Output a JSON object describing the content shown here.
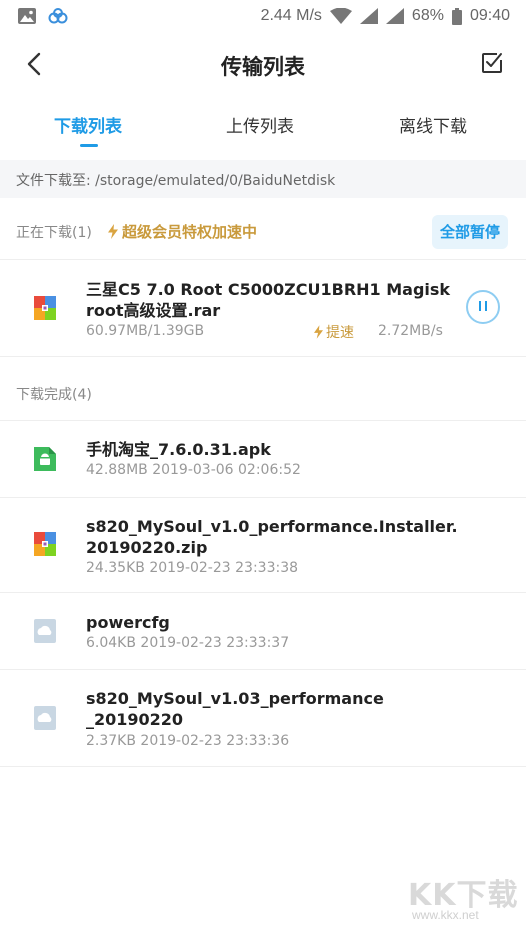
{
  "status_bar": {
    "speed": "2.44 M/s",
    "battery": "68%",
    "time": "09:40",
    "icons": [
      "image-icon",
      "cloud-app-icon",
      "wifi-icon",
      "signal-icon",
      "battery-icon"
    ]
  },
  "header": {
    "title": "传输列表",
    "back_icon": "chevron-left-icon",
    "action_icon": "checkbox-edit-icon"
  },
  "tabs": [
    {
      "label": "下载列表",
      "active": true
    },
    {
      "label": "上传列表",
      "active": false
    },
    {
      "label": "离线下载",
      "active": false
    }
  ],
  "download_path": "文件下载至: /storage/emulated/0/BaiduNetdisk",
  "downloading": {
    "label": "正在下载(1)",
    "vip_text": "超级会员特权加速中",
    "pause_all_label": "全部暂停",
    "items": [
      {
        "name_line1": "三星C5 7.0 Root C5000ZCU1BRH1 Magisk",
        "name_line2": "root高级设置.rar",
        "progress": "60.97MB/1.39GB",
        "speed_tag": "提速",
        "speed": "2.72MB/s"
      }
    ]
  },
  "completed": {
    "label": "下载完成(4)",
    "items": [
      {
        "name_line1": "手机淘宝_7.6.0.31.apk",
        "name_line2": "",
        "meta": "42.88MB 2019-03-06 02:06:52",
        "icon": "android-apk-icon"
      },
      {
        "name_line1": "s820_MySoul_v1.0_performance.Installer.",
        "name_line2": "20190220.zip",
        "meta": "24.35KB 2019-02-23 23:33:38",
        "icon": "zip-archive-icon"
      },
      {
        "name_line1": "powercfg",
        "name_line2": "",
        "meta": "6.04KB 2019-02-23 23:33:37",
        "icon": "unknown-file-icon"
      },
      {
        "name_line1": "s820_MySoul_v1.03_performance",
        "name_line2": "_20190220",
        "meta": "2.37KB 2019-02-23 23:33:36",
        "icon": "unknown-file-icon"
      }
    ]
  },
  "watermark": {
    "text": "KK下载",
    "url": "www.kkx.net"
  },
  "colors": {
    "accent": "#1f9be6",
    "vip_gold": "#c99a3c",
    "muted": "#999999"
  }
}
